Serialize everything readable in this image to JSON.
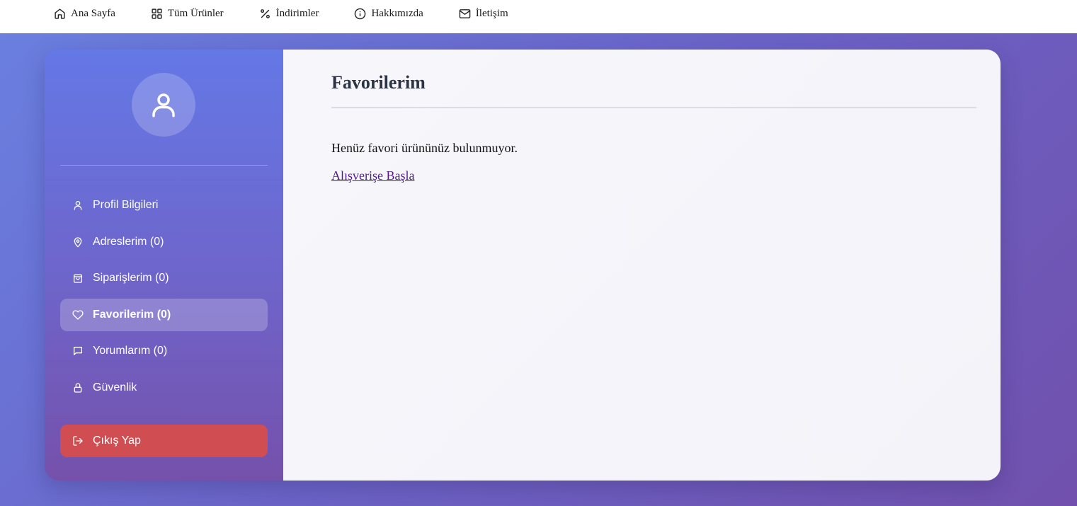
{
  "nav": {
    "items": [
      {
        "label": "Ana Sayfa",
        "icon": "home-icon"
      },
      {
        "label": "Tüm Ürünler",
        "icon": "grid-icon"
      },
      {
        "label": "İndirimler",
        "icon": "percent-icon"
      },
      {
        "label": "Hakkımızda",
        "icon": "info-icon"
      },
      {
        "label": "İletişim",
        "icon": "mail-icon"
      }
    ]
  },
  "sidebar": {
    "avatar_icon": "user-icon",
    "items": [
      {
        "label": "Profil Bilgileri",
        "icon": "user-icon",
        "active": false
      },
      {
        "label": "Adreslerim (0)",
        "icon": "map-pin-icon",
        "active": false
      },
      {
        "label": "Siparişlerim (0)",
        "icon": "shopping-bag-icon",
        "active": false
      },
      {
        "label": "Favorilerim (0)",
        "icon": "heart-icon",
        "active": true
      },
      {
        "label": "Yorumlarım (0)",
        "icon": "message-icon",
        "active": false
      },
      {
        "label": "Güvenlik",
        "icon": "lock-icon",
        "active": false
      }
    ],
    "logout_label": "Çıkış Yap"
  },
  "main": {
    "title": "Favorilerim",
    "empty_message": "Henüz favori ürününüz bulunmuyor.",
    "cta_link": "Alışverişe Başla"
  },
  "colors": {
    "accent_start": "#667eea",
    "accent_end": "#764ba2",
    "logout": "#d04e52",
    "link": "#551a8b"
  }
}
